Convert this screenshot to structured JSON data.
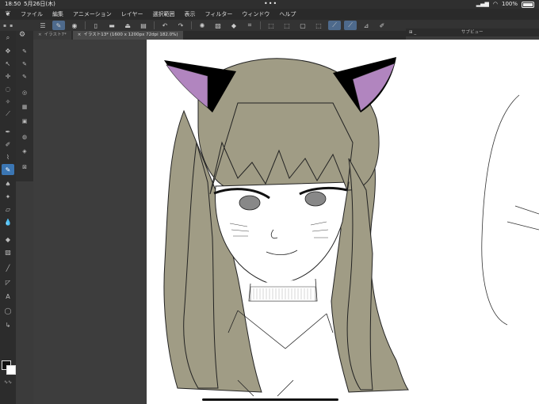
{
  "status": {
    "time": "18:50",
    "date": "5月26日(木)",
    "battery": "100%"
  },
  "menu": {
    "items": [
      "ファイル",
      "編集",
      "アニメーション",
      "レイヤー",
      "選択範囲",
      "表示",
      "フィルター",
      "ウィンドウ",
      "ヘルプ"
    ]
  },
  "tabs": [
    {
      "label": "イラスト7*"
    },
    {
      "label": "イラスト13* (1600 x 1200px 72dpi 182.0%)"
    }
  ],
  "subview": {
    "title": "サブビュー"
  },
  "colors": {
    "hair": "#a09c85",
    "ear_inner": "#b185bf",
    "ear_outer": "#000000",
    "active_tool": "#3b76b3"
  }
}
